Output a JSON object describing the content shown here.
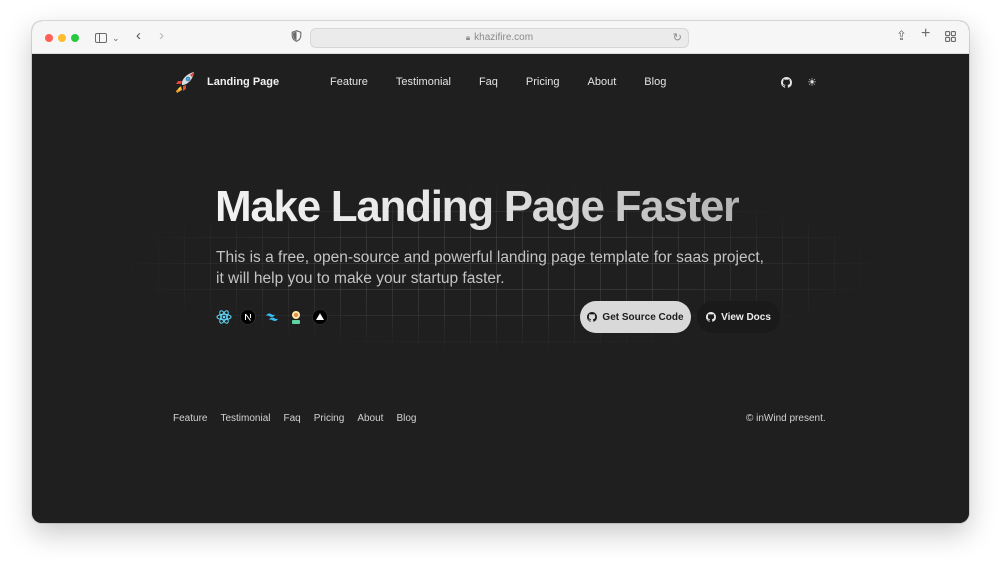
{
  "browser": {
    "url": "khazifire.com"
  },
  "nav": {
    "brand": "Landing Page",
    "links": [
      "Feature",
      "Testimonial",
      "Faq",
      "Pricing",
      "About",
      "Blog"
    ]
  },
  "hero": {
    "title": "Make Landing Page Faster",
    "description": "This is a free, open-source and powerful landing page template for saas project, it will help you to make your startup faster.",
    "tech_icons": [
      "react-icon",
      "nextjs-icon",
      "tailwind-icon",
      "daisy-icon",
      "vercel-icon"
    ],
    "primary_button": "Get Source Code",
    "secondary_button": "View Docs"
  },
  "footer": {
    "links": [
      "Feature",
      "Testimonial",
      "Faq",
      "Pricing",
      "About",
      "Blog"
    ],
    "copyright": "© inWind present."
  },
  "colors": {
    "page_background": "#1f1f1f",
    "primary_button": "#d9d9d9",
    "text": "#e4e4e4"
  }
}
